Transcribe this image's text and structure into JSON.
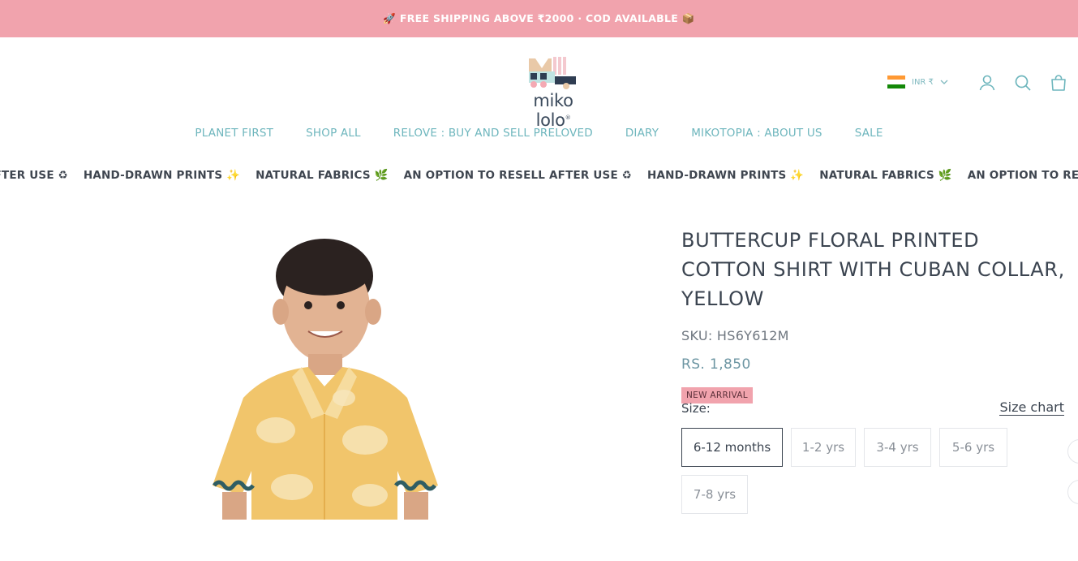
{
  "announcement": {
    "text": "🚀 FREE SHIPPING ABOVE ₹2000 · COD AVAILABLE 📦"
  },
  "header": {
    "logo_text": "miko lolo",
    "currency": "INR ₹",
    "icons": [
      "india-flag-icon",
      "chevron-down-icon",
      "account-icon",
      "search-icon",
      "bag-icon"
    ]
  },
  "nav": {
    "items": [
      "PLANET FIRST",
      "SHOP ALL",
      "RELOVE : BUY AND SELL PRELOVED",
      "DIARY",
      "MIKOTOPIA : ABOUT US",
      "SALE"
    ]
  },
  "marquee": {
    "items": [
      "SELL AFTER USE ♻",
      "HAND-DRAWN PRINTS ✨",
      "NATURAL FABRICS 🌿",
      "AN OPTION TO RESELL AFTER USE ♻",
      "HAND-DRAWN PRINTS ✨",
      "NATURAL FABRICS 🌿",
      "AN OPTION TO RESELL AFTER USE ♻"
    ]
  },
  "product": {
    "title": "BUTTERCUP FLORAL PRINTED COTTON SHIRT WITH CUBAN COLLAR, YELLOW",
    "sku": "SKU: HS6Y612M",
    "price": "RS. 1,850",
    "badge": "NEW ARRIVAL",
    "size_label": "Size:",
    "size_chart_label": "Size chart",
    "sizes": [
      "6-12 months",
      "1-2 yrs",
      "3-4 yrs",
      "5-6 yrs",
      "7-8 yrs"
    ],
    "selected_size": "6-12 months"
  },
  "colors": {
    "announcement_bg": "#f1a3ad",
    "nav_text": "#6eb6bd",
    "price": "#6d96a3",
    "badge_bg": "#f1a3ad"
  }
}
